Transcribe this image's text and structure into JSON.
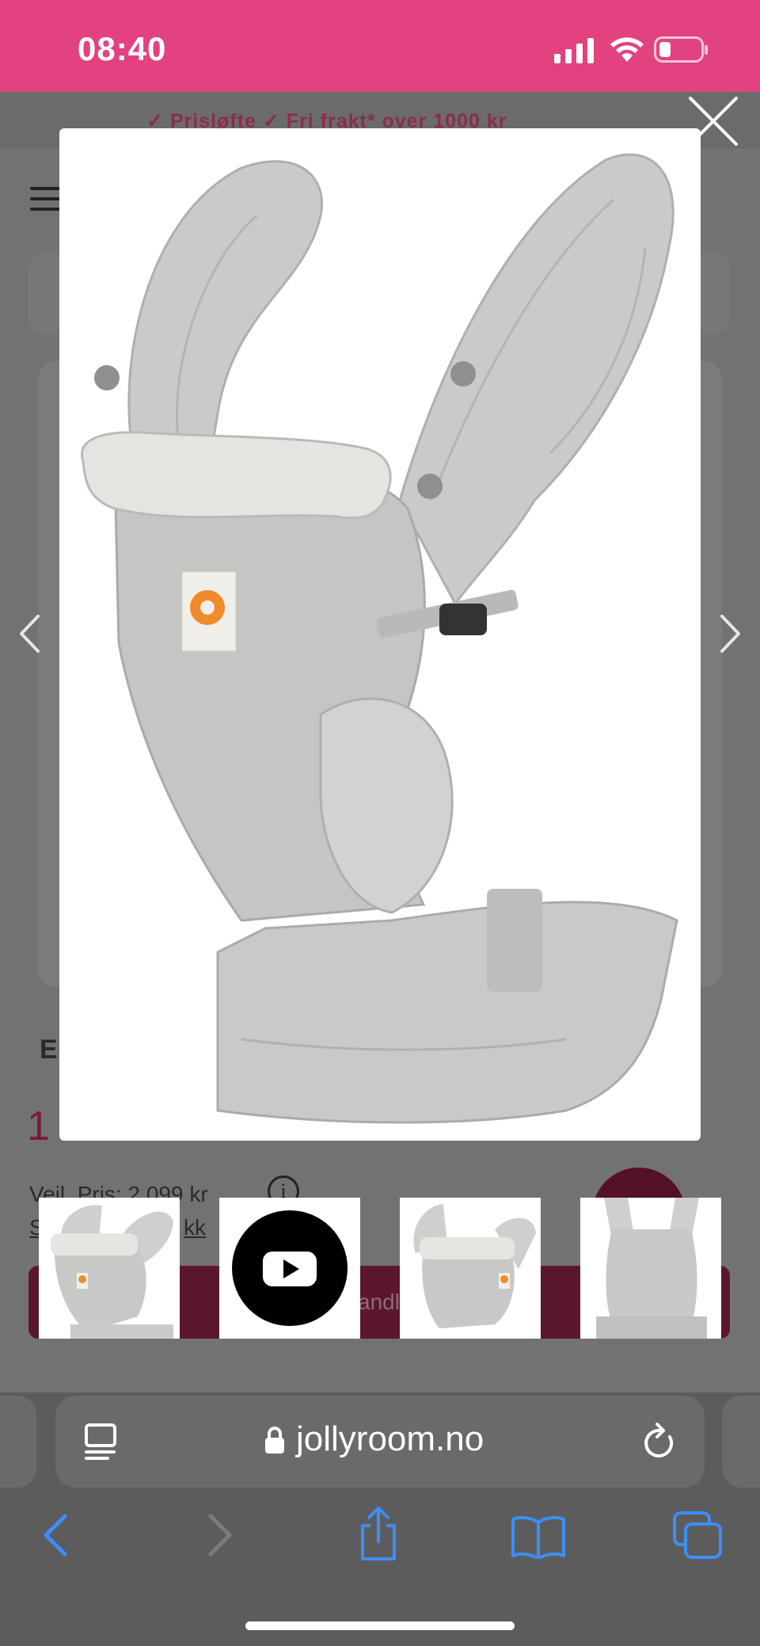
{
  "status_bar": {
    "time": "08:40",
    "color": "#e2427f"
  },
  "page": {
    "usp_text": "✓ Prisløfte   ✓ Fri frakt* over 1000 kr",
    "product_title_fragment": "E",
    "price_fragment": "1",
    "veil_pris": "Veil. Pris: 2 099 kr",
    "link_fragment": "S",
    "link_fragment_end": "kk",
    "cart_button_fragment": "andl",
    "accent_color": "#7a1a38"
  },
  "modal": {
    "main_image": "ergobaby-omni-360-baby-carrier-pearl-grey",
    "close_icon": "close-icon",
    "prev_icon": "chevron-left-icon",
    "next_icon": "chevron-right-icon",
    "thumbnails": [
      {
        "type": "image",
        "icon": "carrier-thumbnail"
      },
      {
        "type": "video",
        "icon": "youtube-play-icon"
      },
      {
        "type": "image",
        "icon": "carrier-thumbnail"
      },
      {
        "type": "image",
        "icon": "carrier-back-thumbnail"
      }
    ]
  },
  "browser": {
    "url": "jollyroom.no",
    "reader_icon": "reader-mode-icon",
    "lock_icon": "lock-icon",
    "reload_icon": "reload-icon",
    "toolbar": {
      "back_icon": "back-arrow-icon",
      "forward_icon": "forward-arrow-icon",
      "share_icon": "share-icon",
      "bookmarks_icon": "bookmarks-icon",
      "tabs_icon": "tabs-icon"
    },
    "link_color": "#3d8ef7"
  }
}
